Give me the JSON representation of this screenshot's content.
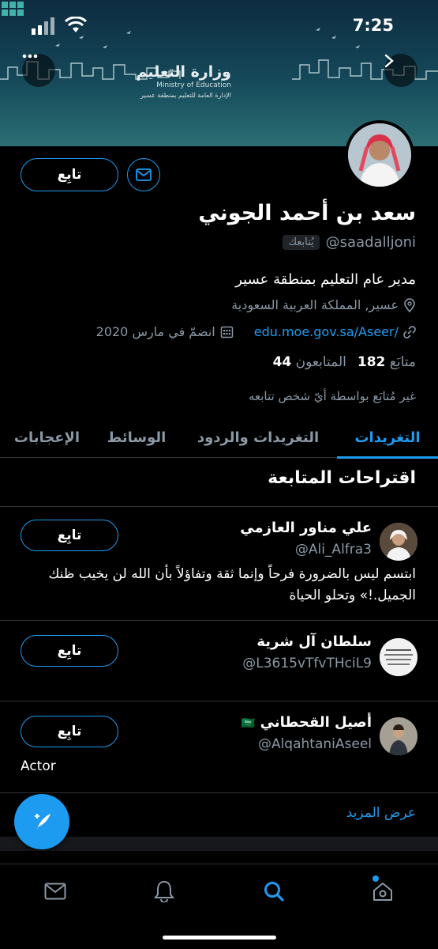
{
  "status_bar": {
    "time": "7:25"
  },
  "banner": {
    "logo_arabic": "وزارة التعليم",
    "logo_english": "Ministry of Education",
    "logo_subtitle": "الإدارة العامة للتعليم بمنطقة عسير"
  },
  "profile": {
    "follow_label": "تابِع",
    "name": "سعد بن أحمد الجوني",
    "handle": "@saadalljoni",
    "follows_you": "يُتابعك",
    "bio": "مدير عام التعليم بمنطقة عسير",
    "location": "عسير, المملكة العربية السعودية",
    "link": "edu.moe.gov.sa/Aseer/",
    "joined": "انضمّ في مارس 2020",
    "following_count": "182",
    "following_label": "متابَع",
    "followers_count": "44",
    "followers_label": "المتابعون",
    "not_followed_note": "غير مُتابَع بواسطة أيّ شخص تتابعه"
  },
  "tabs": [
    {
      "label": "التغريدات",
      "active": true
    },
    {
      "label": "التغريدات والردود",
      "active": false
    },
    {
      "label": "الوسائط",
      "active": false
    },
    {
      "label": "الإعجابات",
      "active": false
    }
  ],
  "suggestions": {
    "title": "اقتراحات المتابعة",
    "items": [
      {
        "name": "علي مناور العازمي",
        "handle": "@Ali_Alfra3",
        "bio": "ابتسم ليس بالضرورة فرحاً وإنما ثقة وتفاؤلاً بأن الله لن يخيب ظنك الجميل.!» وتحلو الحياة",
        "follow_label": "تابِع"
      },
      {
        "name": "سلطان آل شرية",
        "handle": "@L3615vTfvTHciL9",
        "bio": "",
        "follow_label": "تابِع"
      },
      {
        "name": "أصيل القحطاني",
        "flag": "🇸🇦",
        "handle": "@AlqahtaniAseel",
        "bio": "Actor",
        "follow_label": "تابِع"
      }
    ],
    "show_more": "عرض المزيد"
  },
  "colors": {
    "accent": "#1d9bf0",
    "background": "#000000",
    "muted": "#8b98a5"
  },
  "icons": {
    "banner_left": "more-icon",
    "banner_right": "back-chevron-icon",
    "nav": [
      "mail-icon",
      "bell-icon",
      "search-icon",
      "home-icon"
    ],
    "fab": "compose-icon"
  }
}
